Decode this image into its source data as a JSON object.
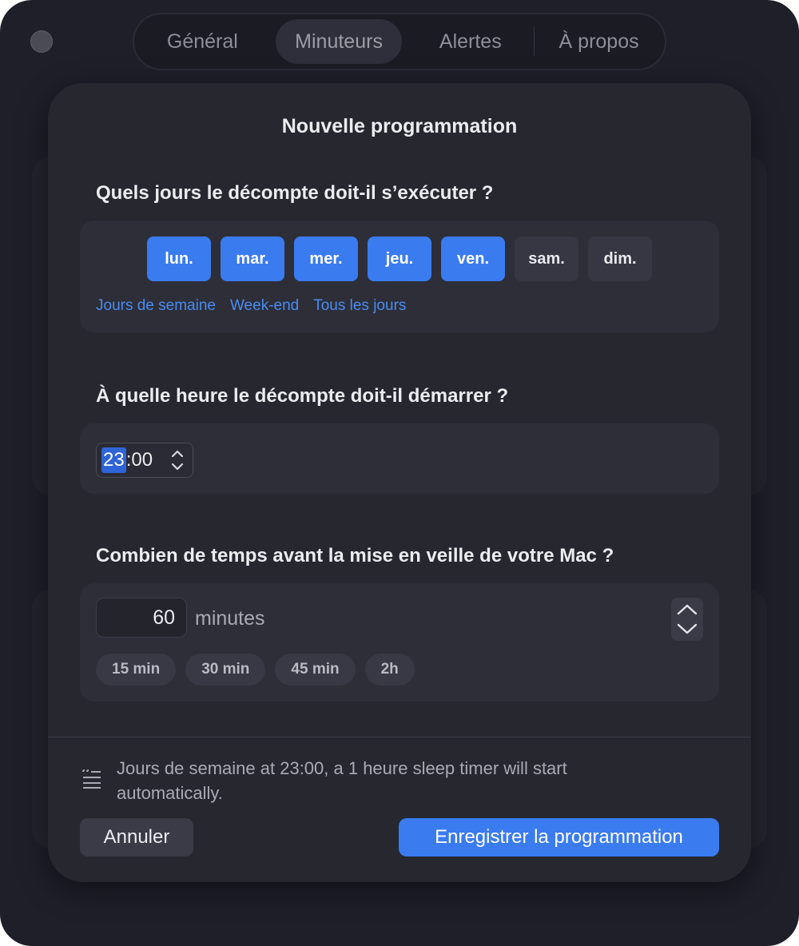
{
  "tabs": [
    {
      "label": "Général"
    },
    {
      "label": "Minuteurs",
      "active": true
    },
    {
      "label": "Alertes"
    },
    {
      "label": "À propos"
    }
  ],
  "sheet": {
    "title": "Nouvelle programmation",
    "days_question": "Quels jours le décompte doit-il s’exécuter ?",
    "days": [
      {
        "label": "lun.",
        "selected": true
      },
      {
        "label": "mar.",
        "selected": true
      },
      {
        "label": "mer.",
        "selected": true
      },
      {
        "label": "jeu.",
        "selected": true
      },
      {
        "label": "ven.",
        "selected": true
      },
      {
        "label": "sam.",
        "selected": false
      },
      {
        "label": "dim.",
        "selected": false
      }
    ],
    "day_shortcuts": [
      "Jours de semaine",
      "Week-end",
      "Tous les jours"
    ],
    "time_question": "À quelle heure le décompte doit-il démarrer ?",
    "time": {
      "hours": "23",
      "separator": ":",
      "minutes": "00"
    },
    "duration_question": "Combien de temps avant la mise en veille de votre Mac ?",
    "duration": {
      "value": "60",
      "unit": "minutes"
    },
    "presets": [
      "15 min",
      "30 min",
      "45 min",
      "2h"
    ],
    "summary": "Jours de semaine at 23:00, a 1 heure sleep timer will start automatically.",
    "cancel_label": "Annuler",
    "save_label": "Enregistrer la programmation"
  },
  "colors": {
    "accent": "#3a7bf0",
    "window_bg": "#1e1f29",
    "sheet_bg": "#26272f",
    "card_bg": "#2d2e38"
  },
  "icons": {
    "window_control": "circle-icon",
    "time_stepper": "chevron-up-down-icon",
    "duration_stepper": "chevron-up-down-icon",
    "summary": "text-quote-icon"
  }
}
